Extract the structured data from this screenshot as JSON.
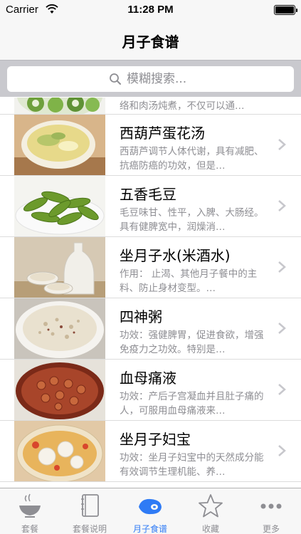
{
  "status_bar": {
    "carrier": "Carrier",
    "time": "11:28 PM"
  },
  "nav": {
    "title": "月子食谱"
  },
  "search": {
    "placeholder": "模糊搜索..."
  },
  "list": {
    "partial_desc": "络和肉汤炖煮，不仅可以通…",
    "items": [
      {
        "name": "西葫芦蛋花汤",
        "desc": "西葫芦调节人体代谢，具有减肥、抗癌防癌的功效，但是…"
      },
      {
        "name": "五香毛豆",
        "desc": "毛豆味甘、性平，入脾、大肠经。具有健脾宽中，润燥消…"
      },
      {
        "name": "坐月子水(米酒水)",
        "desc": "作用： 止渴、其他月子餐中的主料、防止身材变型。…"
      },
      {
        "name": "四神粥",
        "desc": "功效：强健脾胃，促进食欲，增强免疫力之功效。特别是…"
      },
      {
        "name": "血母痛液",
        "desc": "功效：产后子宫凝血并且肚子痛的人，可服用血母痛液来…"
      },
      {
        "name": "坐月子妇宝",
        "desc": "功效：坐月子妇宝中的天然成分能有效调节生理机能、养…"
      }
    ]
  },
  "tabs": [
    {
      "label": "套餐",
      "icon": "bowl-icon"
    },
    {
      "label": "套餐说明",
      "icon": "book-icon"
    },
    {
      "label": "月子食谱",
      "icon": "meat-icon",
      "active": true
    },
    {
      "label": "收藏",
      "icon": "star-icon"
    },
    {
      "label": "更多",
      "icon": "more-icon"
    }
  ],
  "colors": {
    "accent": "#2f7bf5",
    "secondary_text": "#8e8e93"
  }
}
